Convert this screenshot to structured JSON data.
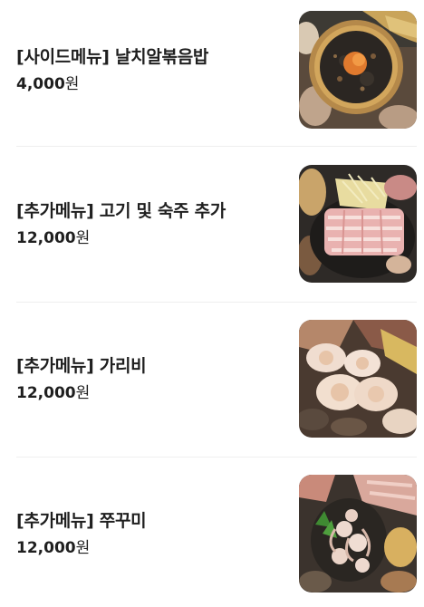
{
  "menu": {
    "items": [
      {
        "name": "[사이드메뉴] 날치알볶음밥",
        "price_number": "4,000",
        "price_unit": "원",
        "image_icon": "fried-rice-photo"
      },
      {
        "name": "[추가메뉴] 고기 및 숙주 추가",
        "price_number": "12,000",
        "price_unit": "원",
        "image_icon": "pork-and-sprouts-photo"
      },
      {
        "name": "[추가메뉴] 가리비",
        "price_number": "12,000",
        "price_unit": "원",
        "image_icon": "scallops-photo"
      },
      {
        "name": "[추가메뉴] 쭈꾸미",
        "price_number": "12,000",
        "price_unit": "원",
        "image_icon": "baby-octopus-photo"
      }
    ]
  }
}
